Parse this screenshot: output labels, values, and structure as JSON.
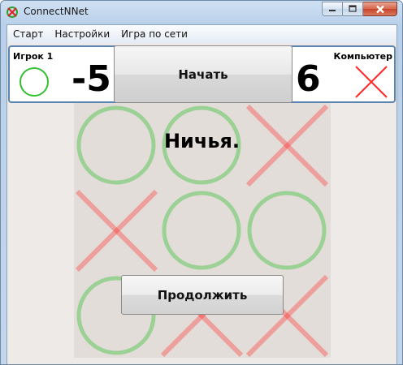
{
  "window": {
    "title": "ConnectNNet",
    "icons": {
      "app": "app-cross-circle-icon",
      "minimize": "minimize-icon",
      "maximize": "maximize-icon",
      "close": "close-icon"
    }
  },
  "menu": {
    "items": [
      {
        "label": "Старт"
      },
      {
        "label": "Настройки"
      },
      {
        "label": "Игра по сети"
      }
    ]
  },
  "scoreboard": {
    "player": {
      "label": "Игрок 1",
      "score": "-5",
      "mark": "circle-icon"
    },
    "computer": {
      "label": "Компьютер",
      "score": "6",
      "mark": "cross-icon"
    },
    "start_label": "Начать"
  },
  "board": {
    "cells": [
      "O",
      "O",
      "X",
      "X",
      "O",
      "O",
      "O",
      "X",
      "X"
    ]
  },
  "result": {
    "message": "Ничья.",
    "continue_label": "Продолжить"
  },
  "colors": {
    "circle": "#33c033",
    "cross": "#ff2a2a",
    "board_bg": "#e3ddd9",
    "panel_border": "#5a84b3"
  }
}
